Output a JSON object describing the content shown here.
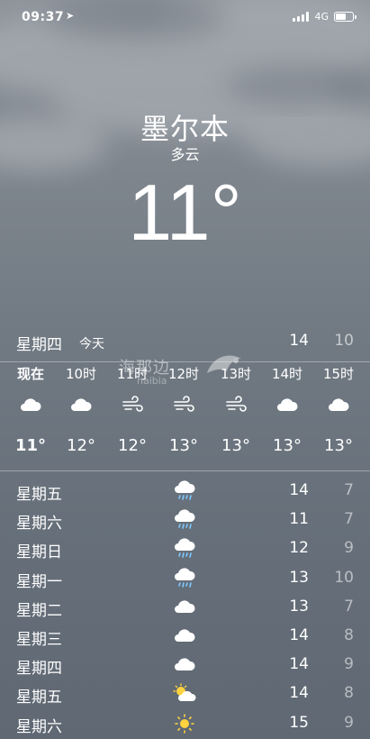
{
  "status": {
    "time": "09:37",
    "network": "4G"
  },
  "header": {
    "city": "墨尔本",
    "condition": "多云",
    "temperature": "11°"
  },
  "today": {
    "day": "星期四",
    "label": "今天",
    "high": "14",
    "low": "10"
  },
  "hourly": [
    {
      "time": "现在",
      "icon": "cloud-icon",
      "temp": "11°"
    },
    {
      "time": "10时",
      "icon": "cloud-icon",
      "temp": "12°"
    },
    {
      "time": "11时",
      "icon": "wind-icon",
      "temp": "12°"
    },
    {
      "time": "12时",
      "icon": "wind-icon",
      "temp": "13°"
    },
    {
      "time": "13时",
      "icon": "wind-icon",
      "temp": "13°"
    },
    {
      "time": "14时",
      "icon": "cloud-icon",
      "temp": "13°"
    },
    {
      "time": "15时",
      "icon": "cloud-icon",
      "temp": "13°"
    }
  ],
  "daily": [
    {
      "day": "星期五",
      "icon": "rain-cloud-icon",
      "high": "14",
      "low": "7"
    },
    {
      "day": "星期六",
      "icon": "rain-cloud-icon",
      "high": "11",
      "low": "7"
    },
    {
      "day": "星期日",
      "icon": "rain-cloud-icon",
      "high": "12",
      "low": "9"
    },
    {
      "day": "星期一",
      "icon": "rain-cloud-icon",
      "high": "13",
      "low": "10"
    },
    {
      "day": "星期二",
      "icon": "cloud-icon",
      "high": "13",
      "low": "7"
    },
    {
      "day": "星期三",
      "icon": "cloud-icon",
      "high": "14",
      "low": "8"
    },
    {
      "day": "星期四",
      "icon": "cloud-icon",
      "high": "14",
      "low": "9"
    },
    {
      "day": "星期五",
      "icon": "partly-sunny-icon",
      "high": "14",
      "low": "8"
    },
    {
      "day": "星期六",
      "icon": "sun-icon",
      "high": "15",
      "low": "9"
    }
  ],
  "watermark": {
    "text": "海那边",
    "sub": "haibia"
  }
}
